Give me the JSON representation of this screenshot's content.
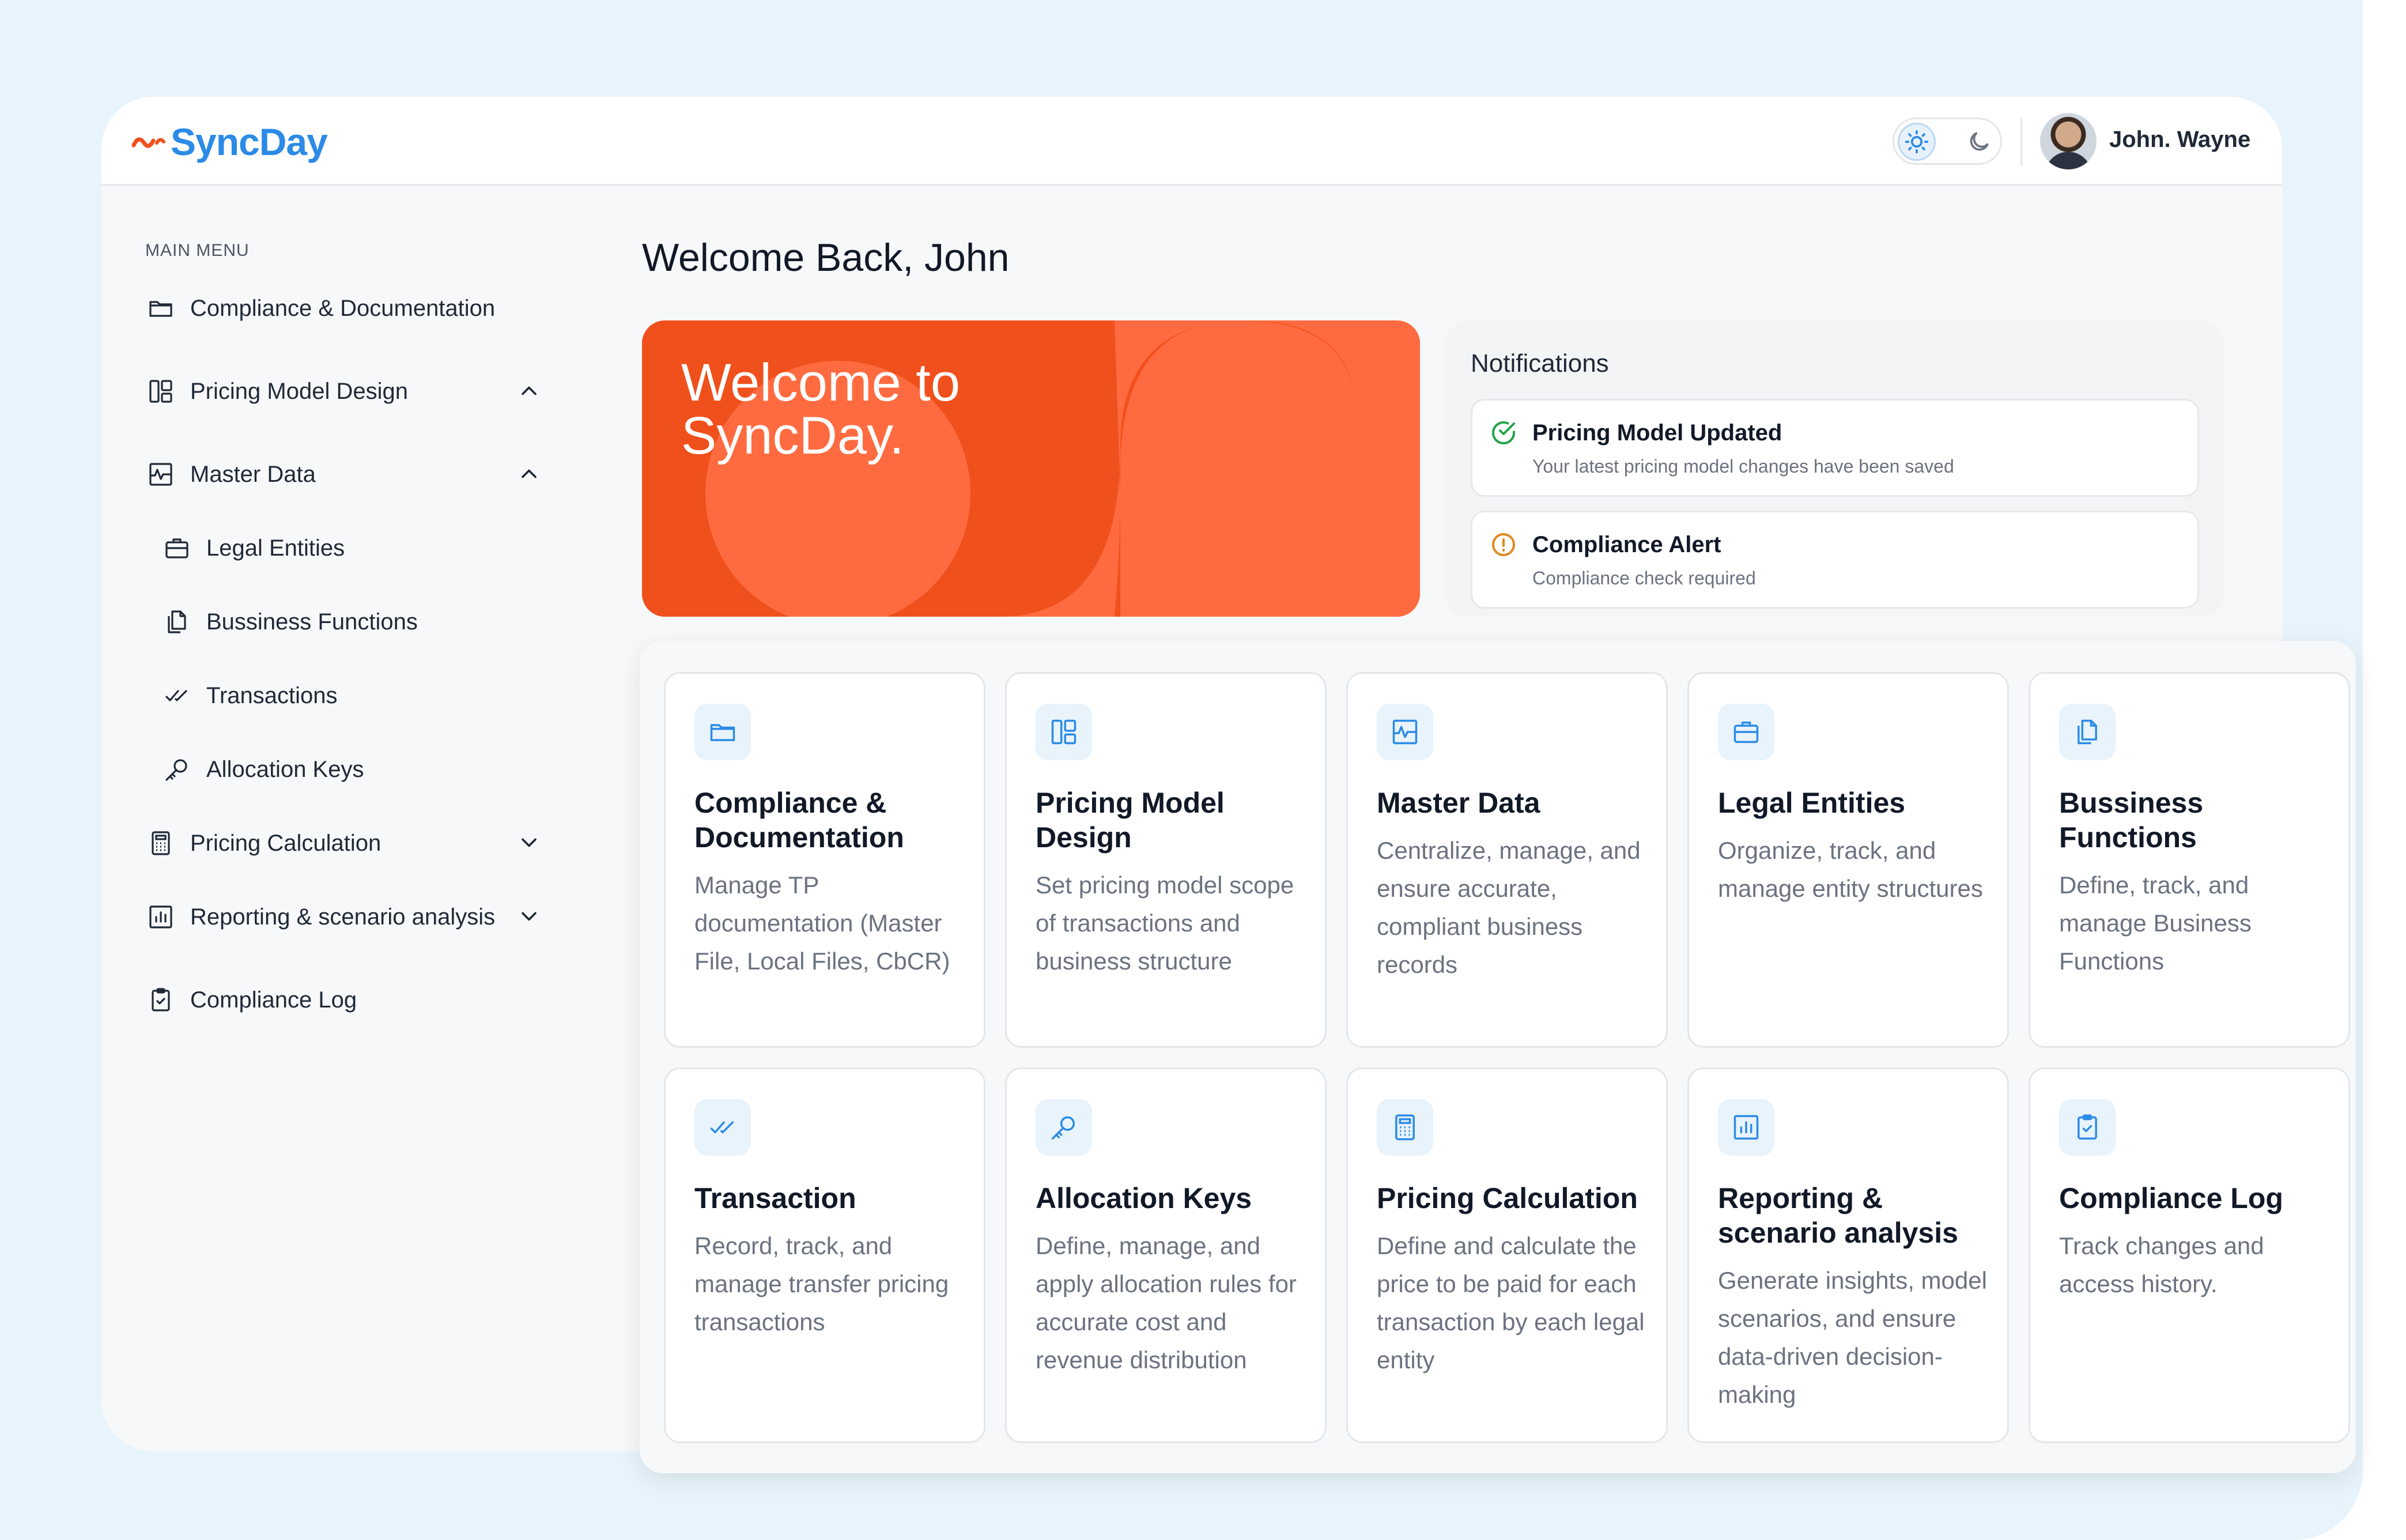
{
  "app": {
    "name": "SyncDay",
    "brand_color": "#2b8be6",
    "accent_color": "#f0501c"
  },
  "header": {
    "user_name": "John. Wayne",
    "theme_icons": [
      "sun-icon",
      "moon-icon"
    ]
  },
  "sidebar": {
    "section_label": "MAIN MENU",
    "items": [
      {
        "label": "Compliance & Documentation",
        "icon": "folder-icon"
      },
      {
        "label": "Pricing Model Design",
        "icon": "layout-icon",
        "expanded": true
      },
      {
        "label": "Master Data",
        "icon": "activity-chart-icon",
        "expanded": true
      },
      {
        "label": "Legal Entities",
        "icon": "briefcase-icon",
        "sub": true
      },
      {
        "label": "Bussiness Functions",
        "icon": "documents-icon",
        "sub": true
      },
      {
        "label": "Transactions",
        "icon": "double-check-icon",
        "sub": true
      },
      {
        "label": "Allocation Keys",
        "icon": "key-icon",
        "sub": true
      },
      {
        "label": "Pricing Calculation",
        "icon": "calculator-icon",
        "expanded": false
      },
      {
        "label": "Reporting & scenario analysis",
        "icon": "bar-chart-icon",
        "expanded": false
      },
      {
        "label": "Compliance Log",
        "icon": "clipboard-check-icon"
      }
    ]
  },
  "main": {
    "welcome": "Welcome Back, John",
    "hero": {
      "line1": "Welcome to",
      "line2": "SyncDay."
    },
    "notifications": {
      "heading": "Notifications",
      "items": [
        {
          "title": "Pricing Model Updated",
          "desc": "Your latest pricing model changes have been saved",
          "status": "success",
          "color": "#22a34a"
        },
        {
          "title": "Compliance Alert",
          "desc": "Compliance check required",
          "status": "warning",
          "color": "#e08a1e"
        }
      ]
    },
    "cards": [
      {
        "title": "Compliance & Documentation",
        "desc": "Manage TP documentation (Master File, Local Files, CbCR)",
        "icon": "folder-icon"
      },
      {
        "title": "Pricing Model Design",
        "desc": "Set pricing model scope of transactions and business structure",
        "icon": "layout-icon"
      },
      {
        "title": "Master Data",
        "desc": "Centralize, manage, and ensure accurate, compliant business records",
        "icon": "activity-chart-icon"
      },
      {
        "title": "Legal Entities",
        "desc": "Organize, track, and manage entity structures",
        "icon": "briefcase-icon"
      },
      {
        "title": "Bussiness Functions",
        "desc": "Define, track, and manage Business Functions",
        "icon": "documents-icon"
      },
      {
        "title": "Transaction",
        "desc": "Record, track, and manage transfer pricing transactions",
        "icon": "double-check-icon"
      },
      {
        "title": "Allocation Keys",
        "desc": "Define, manage, and apply allocation rules for accurate cost and revenue distribution",
        "icon": "key-icon"
      },
      {
        "title": "Pricing Calculation",
        "desc": "Define and calculate the price to be paid for each transaction by each legal entity",
        "icon": "calculator-icon"
      },
      {
        "title": "Reporting & scenario analysis",
        "desc": "Generate insights, model scenarios, and ensure data-driven decision-making",
        "icon": "bar-chart-icon"
      },
      {
        "title": "Compliance Log",
        "desc": "Track changes and access history.",
        "icon": "clipboard-check-icon"
      }
    ]
  }
}
